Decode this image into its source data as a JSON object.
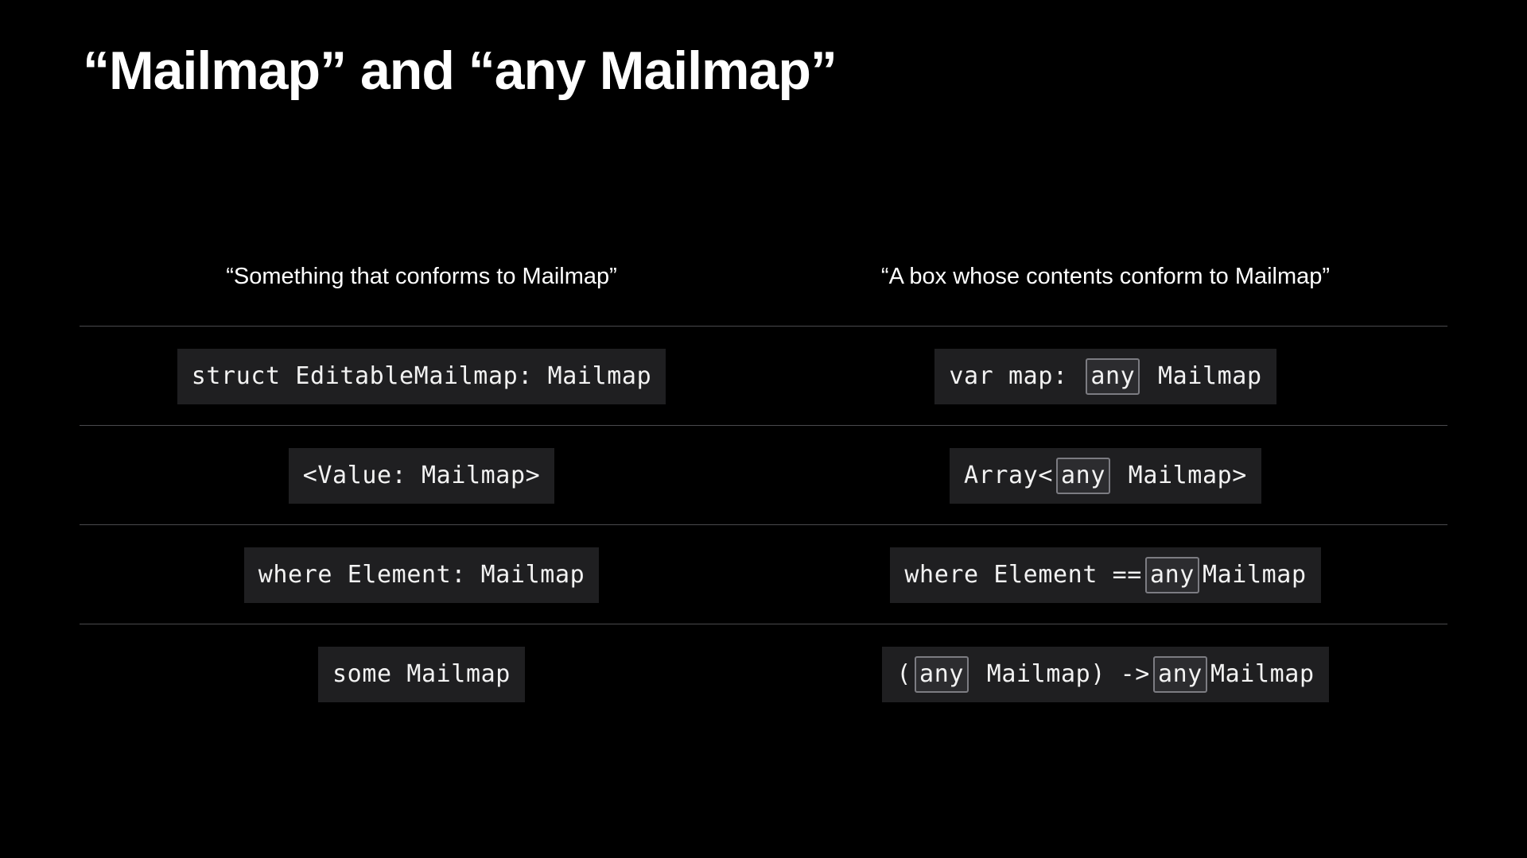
{
  "slide": {
    "title": "“Mailmap” and “any Mailmap”"
  },
  "columns": {
    "left_heading": "“Something that conforms to Mailmap”",
    "right_heading": "“A box whose contents conform to Mailmap”"
  },
  "rows": [
    {
      "left": "struct EditableMailmap: Mailmap",
      "right": {
        "before": "var map: ",
        "keyword": "any",
        "after": " Mailmap"
      }
    },
    {
      "left": "<Value: Mailmap>",
      "right": {
        "before": "Array<",
        "keyword": "any",
        "after": " Mailmap>"
      }
    },
    {
      "left": "where Element: Mailmap",
      "right": {
        "before": "where Element ==",
        "keyword": "any",
        "after": "Mailmap"
      }
    },
    {
      "left": "some Mailmap",
      "right": {
        "before": "(",
        "keyword": "any",
        "middle": " Mailmap) ->",
        "keyword2": "any",
        "after": "Mailmap"
      }
    }
  ],
  "colors": {
    "background": "#000000",
    "code_chip": "#1f1f21",
    "divider": "#4a4a4d",
    "keyword_box_border": "#7c7c82"
  }
}
